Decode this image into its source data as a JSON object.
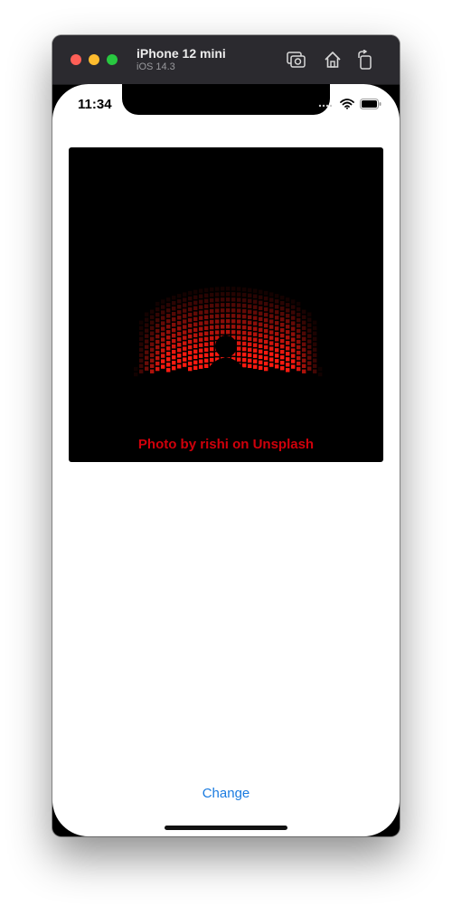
{
  "simulator": {
    "device_name": "iPhone 12 mini",
    "os_version": "iOS 14.3",
    "toolbar": {
      "screenshot_icon": "camera-screenshot-icon",
      "home_icon": "home-icon",
      "rotate_icon": "rotate-icon"
    }
  },
  "status_bar": {
    "time": "11:34",
    "icons": [
      "signal-icon",
      "wifi-icon",
      "battery-icon"
    ]
  },
  "photo": {
    "caption": "Photo by rishi on Unsplash",
    "caption_color": "#d0000b"
  },
  "actions": {
    "change_label": "Change",
    "tint_color": "#1a7be0"
  }
}
